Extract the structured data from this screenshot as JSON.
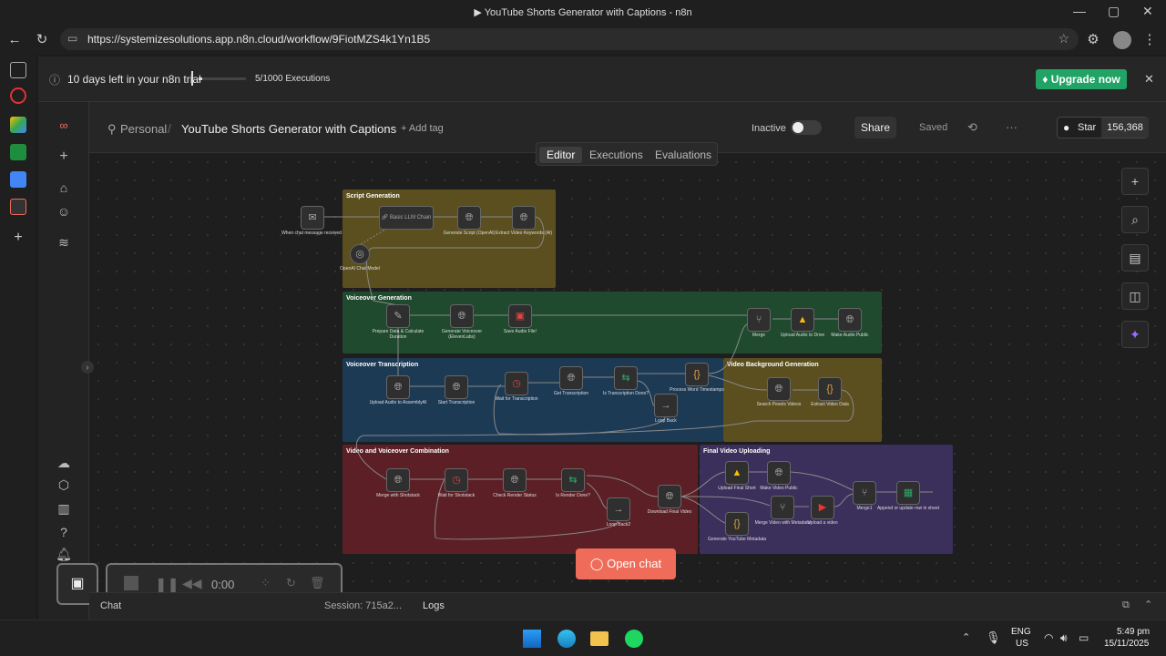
{
  "browser": {
    "window_title": "▶ YouTube Shorts Generator with Captions - n8n",
    "url": "https://systemizesolutions.app.n8n.cloud/workflow/9FiotMZS4k1Yn1B5"
  },
  "trial_banner": {
    "message": "10 days left in your n8n trial",
    "executions": "5/1000 Executions",
    "upgrade_label": "Upgrade now"
  },
  "header": {
    "project": "Personal",
    "workflow_name": "YouTube Shorts Generator with Captions",
    "add_tag": "+ Add tag",
    "status": "Inactive",
    "share": "Share",
    "saved": "Saved",
    "star": "Star",
    "star_count": "156,368"
  },
  "tabs": [
    "Editor",
    "Executions",
    "Evaluations"
  ],
  "groups": [
    {
      "title": "Script Generation",
      "color": "#5b4f1f"
    },
    {
      "title": "Voiceover Generation",
      "color": "#1f4a2e"
    },
    {
      "title": "Voiceover Transcription",
      "color": "#1d3a55"
    },
    {
      "title": "Video Background Generation",
      "color": "#5b4f1f"
    },
    {
      "title": "Video and Voiceover Combination",
      "color": "#5c1f26"
    },
    {
      "title": "Final Video Uploading",
      "color": "#3b2f5c"
    }
  ],
  "nodes": {
    "chat_trigger": "When chat message received",
    "llm_chain": "Basic LLM Chain",
    "gen_script": "Generate Script (OpenAI)",
    "extract_keywords": "Extract Video Keywords (AI)",
    "openai_model": "OpenAI Chat Model",
    "prepare_data": "Prepare Data & Calculate Duration",
    "gen_voiceover": "Generate Voiceover (ElevenLabs)",
    "save_audio": "Save Audio File!",
    "merge": "Merge",
    "upload_drive": "Upload Audio to Drive",
    "make_public": "Make Audio Public",
    "upload_assembly": "Upload Audio to AssemblyAI",
    "start_transcription": "Start Transcription",
    "wait_transcription": "Wait for Transcription",
    "get_transcription": "Get Transcription",
    "is_done": "Is Transcription Done?",
    "process_timestamps": "Process Word Timestamps",
    "loop_back": "Loop Back",
    "search_pexels": "Search Pexels Videos",
    "extract_video_data": "Extract Video Data",
    "merge_shotstack": "Merge with Shotstack",
    "wait_shotstack": "Wait for Shotstack",
    "check_render": "Check Render Status",
    "is_render_done": "Is Render Done?",
    "loop_back2": "Loop Back2",
    "download_final": "Download Final Video",
    "upload_final_short": "Upload Final Short",
    "make_video_public": "Make Video Public",
    "merge_metadata": "Merge Video with Metadata",
    "upload_video": "Upload a video",
    "merge1": "Merge1",
    "append_sheet": "Append or update row in sheet",
    "gen_metadata": "Generate YouTube Metadata"
  },
  "open_chat": "Open chat",
  "bottom": {
    "chat": "Chat",
    "session": "Session: 715a2...",
    "logs": "Logs"
  },
  "recorder": {
    "time": "0:00"
  },
  "taskbar": {
    "lang": "ENG",
    "region": "US",
    "time": "5:49 pm",
    "date": "15/11/2025"
  },
  "colors": {
    "accent": "#ef6c5a",
    "upgrade": "#21a366"
  }
}
